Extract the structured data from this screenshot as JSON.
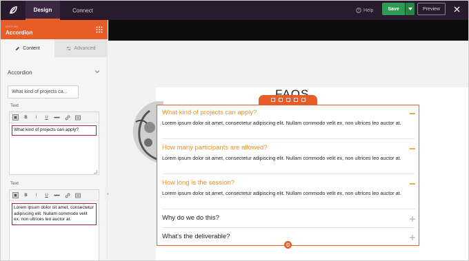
{
  "topbar": {
    "tabs": [
      {
        "label": "Design"
      },
      {
        "label": "Connect"
      }
    ],
    "help_label": "Help",
    "save_label": "Save",
    "preview_label": "Preview"
  },
  "sidebar": {
    "editing_label": "EDITING",
    "title": "Accordion",
    "tabs": [
      {
        "label": "Content"
      },
      {
        "label": "Advanced"
      }
    ],
    "section_title": "Accordion",
    "item_title_value": "What kind of projects ca...",
    "fields": [
      {
        "label": "Text",
        "content": "What kind of projects can apply?"
      },
      {
        "label": "Text",
        "content": "Lorem ipsum dolor sit amet, consectetur adipiscing elit. Nullam commodo velit ex, non ultrices leo auctor at."
      }
    ],
    "toolbar_buttons": [
      "B",
      "I",
      "U",
      "ABC"
    ]
  },
  "canvas": {
    "heading": "FAQS",
    "accordion": [
      {
        "question": "What kind of projects can apply?",
        "answer": "Lorem ipsum dolor sit amet, consectetur adipiscing elit. Nullam commodo velit ex, non ultrices leo auctor at.",
        "expanded": true
      },
      {
        "question": "How many participants are allowed?",
        "answer": "Lorem ipsum dolor sit amet, consectetur adipiscing elit. Nullam commodo velit ex, non ultrices leo auctor at.",
        "expanded": true
      },
      {
        "question": "How long is the session?",
        "answer": "Lorem ipsum dolor sit amet, consectetur adipiscing elit. Nullam commodo velit ex, non ultrices leo auctor at.",
        "expanded": true
      },
      {
        "question": "Why do we do this?",
        "answer": "",
        "expanded": false
      },
      {
        "question": "What's the deliverable?",
        "answer": "",
        "expanded": false
      }
    ]
  },
  "colors": {
    "topbar": "#2a1a2e",
    "accent": "#e85d27",
    "save": "#2e9a53",
    "question_active": "#e8912b",
    "highlight_border": "#b01e2f"
  }
}
